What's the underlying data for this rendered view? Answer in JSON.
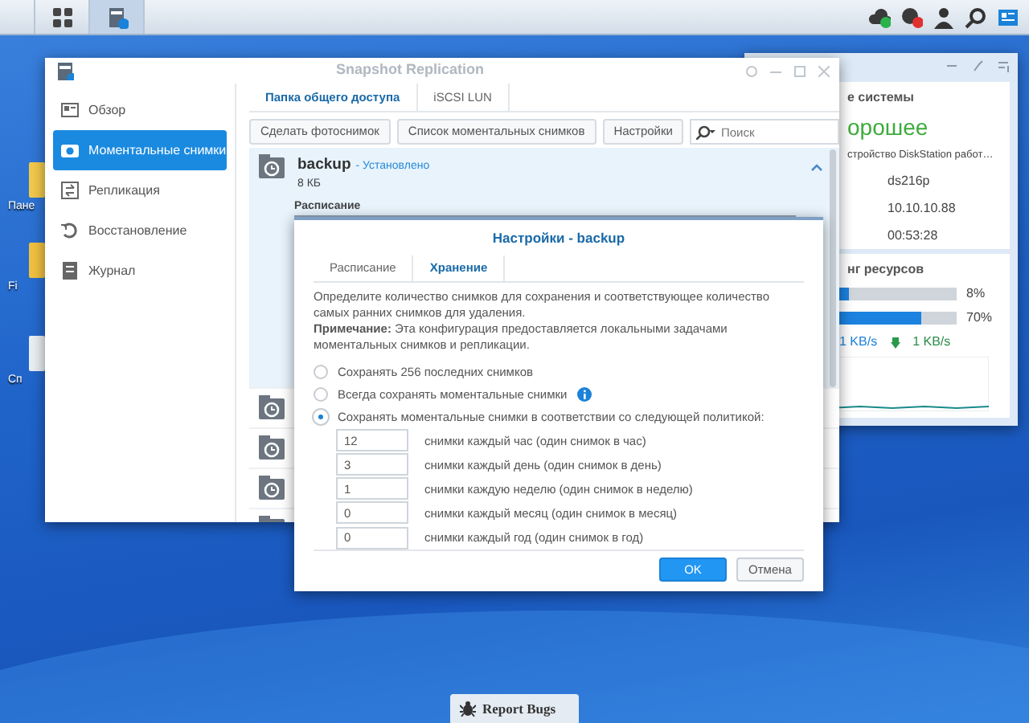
{
  "taskbar": {
    "buttons": [
      {
        "kind": "apps",
        "selected": false
      },
      {
        "kind": "snapshot",
        "selected": true
      }
    ],
    "tray": [
      {
        "kind": "cloud"
      },
      {
        "kind": "notifications"
      },
      {
        "kind": "user"
      },
      {
        "kind": "search"
      },
      {
        "kind": "widgets"
      }
    ]
  },
  "desktop_icons": [
    {
      "label": "Пане"
    },
    {
      "label": "Fi"
    },
    {
      "label": "Сп"
    }
  ],
  "main_window": {
    "title": "Snapshot Replication",
    "sidebar": [
      {
        "label": "Обзор",
        "kind": "overview",
        "selected": false
      },
      {
        "label": "Моментальные снимки",
        "kind": "camera",
        "selected": true
      },
      {
        "label": "Репликация",
        "kind": "replication",
        "selected": false
      },
      {
        "label": "Восстановление",
        "kind": "restore",
        "selected": false
      },
      {
        "label": "Журнал",
        "kind": "log",
        "selected": false
      }
    ],
    "tabs": [
      {
        "label": "Папка общего доступа",
        "selected": true
      },
      {
        "label": "iSCSI LUN",
        "selected": false
      }
    ],
    "toolbar": {
      "buttons": [
        "Сделать фотоснимок",
        "Список моментальных снимков",
        "Настройки"
      ],
      "search": {
        "placeholder": "Поиск"
      }
    },
    "shares": [
      {
        "name": "backup",
        "status": "- Установлено",
        "size": "8 КБ",
        "detail_label": "Расписание",
        "expanded": true
      },
      {
        "expanded": false
      },
      {
        "expanded": false
      },
      {
        "expanded": false
      },
      {
        "expanded": false
      }
    ]
  },
  "widget": {
    "system_title": "е системы",
    "status": "орошее",
    "description": "стройство DiskStation работ…",
    "values": [
      "ds216p",
      "10.10.10.88",
      "00:53:28"
    ],
    "resources_title": "нг ресурсов",
    "meters": [
      {
        "level": 0.08,
        "reading": "8%"
      },
      {
        "level": 0.7,
        "reading": "70%"
      }
    ],
    "upload": "1 KB/s",
    "download": "1 KB/s"
  },
  "dialog": {
    "title": "Настройки - backup",
    "tabs": [
      {
        "label": "Расписание",
        "selected": false
      },
      {
        "label": "Хранение",
        "selected": true
      }
    ],
    "description": "Определите количество снимков для сохранения и соответствующее количество самых ранних снимков для удаления.",
    "note": "**Примечание:** Эта конфигурация предоставляется локальными задачами моментальных снимков и репликации.",
    "options": [
      {
        "label": "Сохранять 256 последних снимков",
        "selected": false,
        "info": false
      },
      {
        "label": "Всегда сохранять моментальные снимки",
        "selected": false,
        "info": true
      },
      {
        "label": "Сохранять моментальные снимки в соответствии со следующей политикой:",
        "selected": true,
        "info": false
      }
    ],
    "policy": [
      {
        "value": "12",
        "label": "снимки каждый час (один снимок в час)"
      },
      {
        "value": "3",
        "label": "снимки каждый день (один снимок в день)"
      },
      {
        "value": "1",
        "label": "снимки каждую неделю (один снимок в неделю)"
      },
      {
        "value": "0",
        "label": "снимки каждый месяц (один снимок в месяц)"
      },
      {
        "value": "0",
        "label": "снимки каждый год (один снимок в год)"
      }
    ],
    "buttons": [
      {
        "label": "OK",
        "kind": "primary"
      },
      {
        "label": "Отмена",
        "kind": "secondary"
      }
    ]
  },
  "report_button": "Report Bugs"
}
